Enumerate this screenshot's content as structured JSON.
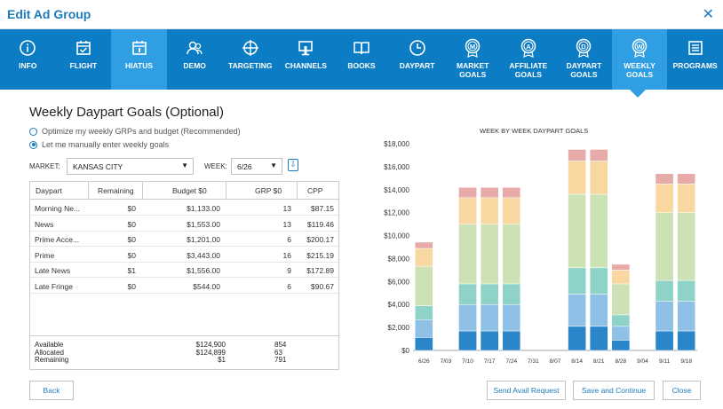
{
  "dialog": {
    "title": "Edit Ad Group",
    "close_glyph": "✕"
  },
  "nav": [
    {
      "id": "info",
      "label": "INFO",
      "icon": "info-icon"
    },
    {
      "id": "flight",
      "label": "FLIGHT",
      "icon": "calendar-check-icon"
    },
    {
      "id": "hiatus",
      "label": "HIATUS",
      "icon": "calendar-icon",
      "active": true
    },
    {
      "id": "demo",
      "label": "DEMO",
      "icon": "people-icon"
    },
    {
      "id": "targeting",
      "label": "TARGETING",
      "icon": "crosshair-icon"
    },
    {
      "id": "channels",
      "label": "CHANNELS",
      "icon": "tv-icon"
    },
    {
      "id": "books",
      "label": "BOOKS",
      "icon": "book-icon"
    },
    {
      "id": "daypart",
      "label": "DAYPART",
      "icon": "clock-icon"
    },
    {
      "id": "market-goals",
      "label": "MARKET\nGOALS",
      "icon": "badge-m-icon"
    },
    {
      "id": "affiliate-goals",
      "label": "AFFILIATE\nGOALS",
      "icon": "badge-a-icon"
    },
    {
      "id": "daypart-goals",
      "label": "DAYPART\nGOALS",
      "icon": "badge-d-icon"
    },
    {
      "id": "weekly-goals",
      "label": "WEEKLY\nGOALS",
      "icon": "badge-w-icon",
      "selected": true
    },
    {
      "id": "programs",
      "label": "PROGRAMS",
      "icon": "list-icon"
    }
  ],
  "heading": "Weekly Daypart Goals (Optional)",
  "options": {
    "optimize": "Optimize my weekly GRPs and budget (Recommended)",
    "manual": "Let me manually enter weekly goals"
  },
  "market": {
    "label": "MARKET:",
    "value": "KANSAS CITY"
  },
  "week": {
    "label": "WEEK:",
    "value": "6/26"
  },
  "table": {
    "headers": [
      "Daypart",
      "Remaining",
      "Budget $0",
      "GRP $0",
      "CPP"
    ],
    "rows": [
      [
        "Morning Ne...",
        "$0",
        "$1,133.00",
        "13",
        "$87.15"
      ],
      [
        "News",
        "$0",
        "$1,553.00",
        "13",
        "$119.46"
      ],
      [
        "Prime Acce...",
        "$0",
        "$1,201.00",
        "6",
        "$200.17"
      ],
      [
        "Prime",
        "$0",
        "$3,443.00",
        "16",
        "$215.19"
      ],
      [
        "Late News",
        "$1",
        "$1,556.00",
        "9",
        "$172.89"
      ],
      [
        "Late Fringe",
        "$0",
        "$544.00",
        "6",
        "$90.67"
      ]
    ],
    "summary": {
      "labels": "Available\nAllocated\nRemaining",
      "budget": "$124,900\n$124,899\n$1",
      "grp": "854\n63\n791"
    }
  },
  "buttons": {
    "back": "Back",
    "send_avail": "Send Avail Request",
    "save_continue": "Save and Continue",
    "close": "Close"
  },
  "colors": {
    "brand": "#0c7dc4",
    "active_tab": "#2f9ee3",
    "series": [
      "#2a86c8",
      "#8fc0e6",
      "#8fd3c8",
      "#cde2b4",
      "#f8d7a0",
      "#e8a9a9"
    ]
  },
  "chart_data": {
    "type": "bar",
    "stacked": true,
    "title": "WEEK BY WEEK DAYPART GOALS",
    "categories": [
      "6/26",
      "7/03",
      "7/10",
      "7/17",
      "7/24",
      "7/31",
      "8/07",
      "8/14",
      "8/21",
      "8/28",
      "9/04",
      "9/11",
      "9/18"
    ],
    "ylim": [
      0,
      18000
    ],
    "yticks": [
      "$0",
      "$2,000",
      "$4,000",
      "$6,000",
      "$8,000",
      "$10,000",
      "$12,000",
      "$14,000",
      "$16,000",
      "$18,000"
    ],
    "grid": false,
    "series": [
      {
        "values": [
          1133,
          0,
          1700,
          1700,
          1700,
          0,
          0,
          2100,
          2100,
          900,
          0,
          1700,
          1700
        ]
      },
      {
        "values": [
          1553,
          0,
          2300,
          2300,
          2300,
          0,
          0,
          2800,
          2800,
          1200,
          0,
          2600,
          2600
        ]
      },
      {
        "values": [
          1201,
          0,
          1800,
          1800,
          1800,
          0,
          0,
          2300,
          2300,
          1000,
          0,
          1800,
          1800
        ]
      },
      {
        "values": [
          3443,
          0,
          5200,
          5200,
          5200,
          0,
          0,
          6400,
          6400,
          2700,
          0,
          5900,
          5900
        ]
      },
      {
        "values": [
          1556,
          0,
          2300,
          2300,
          2300,
          0,
          0,
          2900,
          2900,
          1200,
          0,
          2500,
          2500
        ]
      },
      {
        "values": [
          544,
          0,
          900,
          900,
          900,
          0,
          0,
          1000,
          1000,
          500,
          0,
          900,
          900
        ]
      }
    ]
  }
}
